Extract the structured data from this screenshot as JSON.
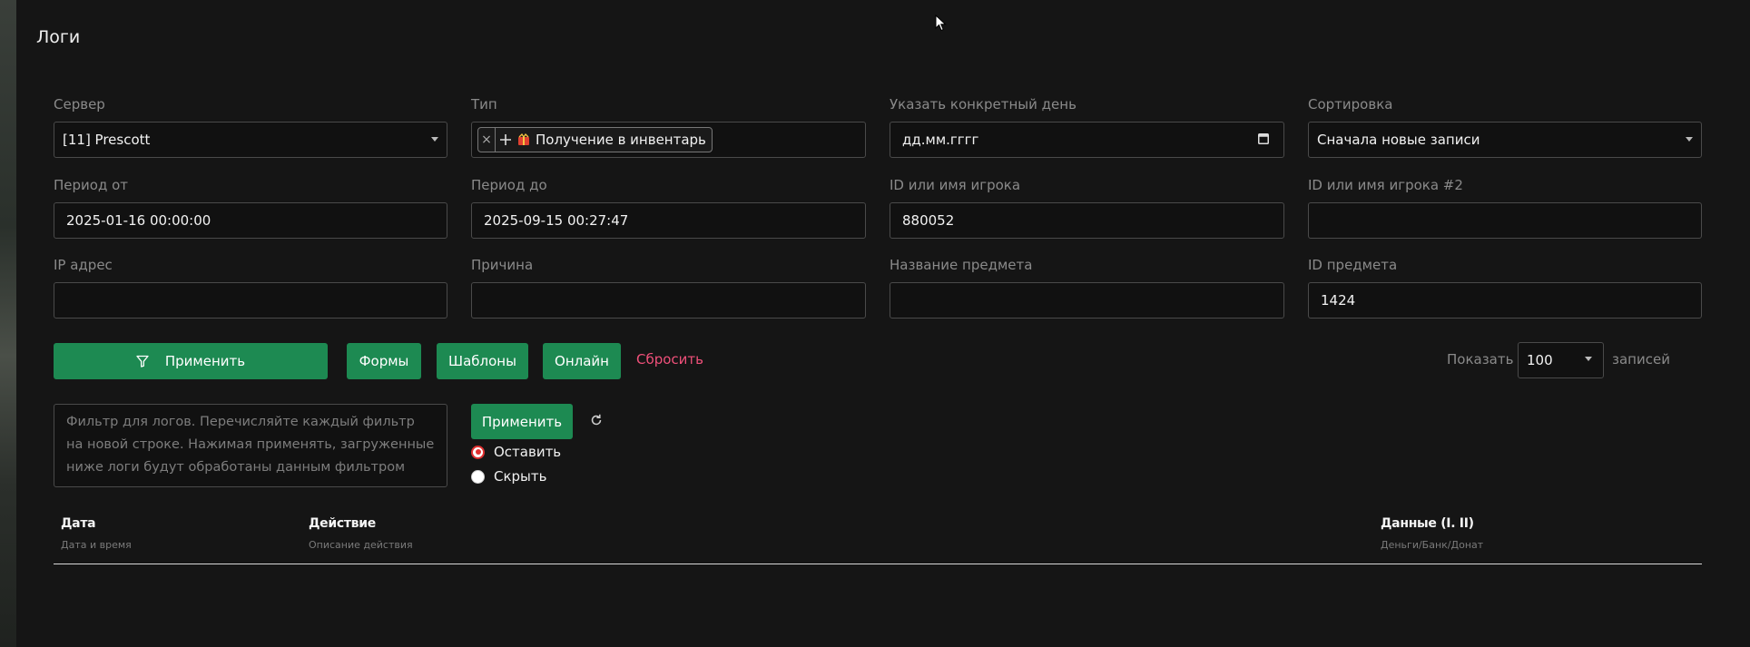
{
  "page": {
    "title": "Логи"
  },
  "filters": {
    "server": {
      "label": "Сервер",
      "value": "[11] Prescott"
    },
    "type": {
      "label": "Тип",
      "tag_remove": "×",
      "tag_label": "Получение в инвентарь"
    },
    "day": {
      "label": "Указать конкретный день",
      "placeholder": "дд.мм.гггг"
    },
    "sort": {
      "label": "Сортировка",
      "value": "Сначала новые записи"
    },
    "period_from": {
      "label": "Период от",
      "value": "2025-01-16 00:00:00"
    },
    "period_to": {
      "label": "Период до",
      "value": "2025-09-15 00:27:47"
    },
    "player": {
      "label": "ID или имя игрока",
      "value": "880052"
    },
    "player2": {
      "label": "ID или имя игрока #2",
      "value": ""
    },
    "ip": {
      "label": "IP адрес",
      "value": ""
    },
    "reason": {
      "label": "Причина",
      "value": ""
    },
    "item_name": {
      "label": "Название предмета",
      "value": ""
    },
    "item_id": {
      "label": "ID предмета",
      "value": "1424"
    }
  },
  "actions": {
    "apply": "Применить",
    "forms": "Формы",
    "templates": "Шаблоны",
    "online": "Онлайн",
    "reset": "Сбросить",
    "show_label": "Показать",
    "per_page": "100",
    "records_label": "записей"
  },
  "log_filter": {
    "placeholder": "Фильтр для логов. Перечисляйте каждый фильтр на новой строке. Нажимая применять, загруженные ниже логи будут обработаны данным фильтром",
    "apply": "Применить",
    "keep": "Оставить",
    "hide": "Скрыть"
  },
  "table": {
    "columns": [
      {
        "title": "Дата",
        "subtitle": "Дата и время"
      },
      {
        "title": "Действие",
        "subtitle": "Описание действия"
      },
      {
        "title": "Данные (I. II)",
        "subtitle": "Деньги/Банк/Донат"
      }
    ]
  },
  "colors": {
    "accent": "#1d8a52",
    "reset": "#f0507a",
    "radio_selected": "#e03030",
    "background": "#151515"
  },
  "icons": [
    "calendar-icon",
    "plus-icon",
    "gift-icon",
    "filter-icon",
    "refresh-icon",
    "chevron-down-icon"
  ]
}
